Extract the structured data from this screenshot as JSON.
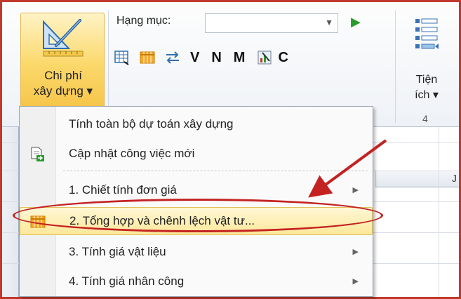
{
  "ribbon": {
    "chi_phi_button": {
      "label_line1": "Chi phí",
      "label_line2": "xây dựng ▾",
      "icon": "drafting-tools-icon"
    },
    "hang_muc": {
      "label": "Hạng mục:",
      "value": "",
      "play_icon": "play-icon"
    },
    "toolbar_letters": [
      "V",
      "N",
      "M",
      "C"
    ],
    "tien_ich": {
      "label_line1": "Tiện",
      "label_line2": "ích ▾",
      "icon": "list-icon"
    },
    "group_number": "4"
  },
  "sheet": {
    "column_letter": "J"
  },
  "menu": {
    "items": [
      {
        "label": "Tính toàn bộ dự toán xây dựng",
        "icon": "",
        "submenu": false,
        "highlighted": false
      },
      {
        "label": "Cập nhật công việc mới",
        "icon": "document-update-icon",
        "submenu": false,
        "highlighted": false
      },
      {
        "label": "1. Chiết tính đơn giá",
        "icon": "",
        "submenu": true,
        "highlighted": false
      },
      {
        "label": "2. Tổng hợp và chênh lệch vật tư...",
        "icon": "table-icon",
        "submenu": false,
        "highlighted": true
      },
      {
        "label": "3. Tính giá vật liệu",
        "icon": "",
        "submenu": true,
        "highlighted": false
      },
      {
        "label": "4. Tính giá nhân công",
        "icon": "",
        "submenu": true,
        "highlighted": false
      }
    ]
  },
  "colors": {
    "highlight": "#fde89a",
    "annotation_red": "#c42222",
    "frame_red": "#c0392b"
  }
}
